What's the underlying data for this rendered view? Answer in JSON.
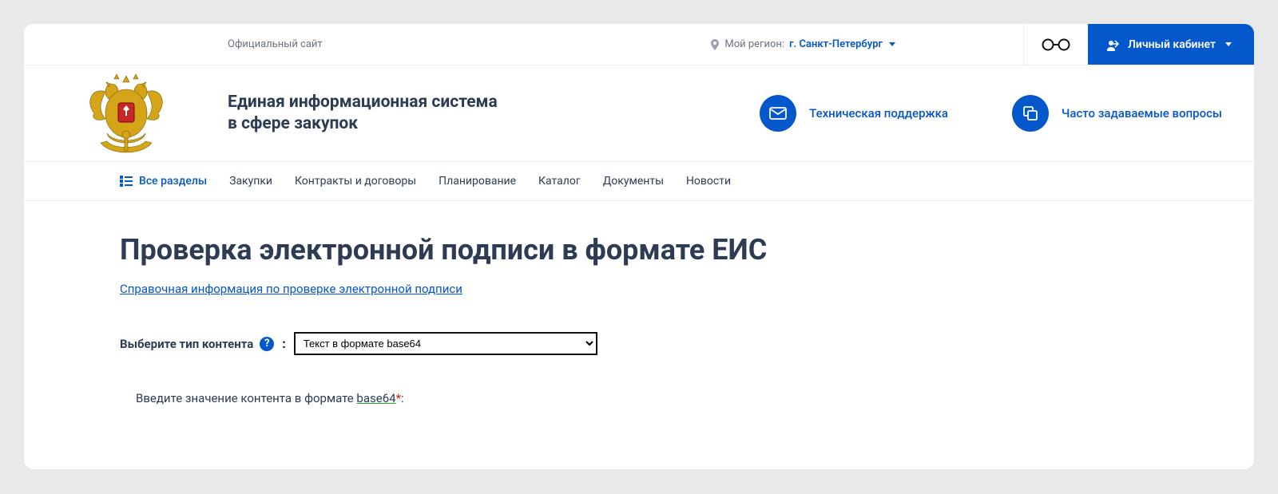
{
  "topbar": {
    "official": "Официальный сайт",
    "region_label": "Мой регион:",
    "region_value": "г. Санкт-Петербург",
    "cabinet": "Личный кабинет"
  },
  "header": {
    "title_line1": "Единая информационная система",
    "title_line2": "в сфере закупок",
    "support": "Техническая поддержка",
    "faq": "Часто задаваемые вопросы"
  },
  "nav": {
    "all": "Все разделы",
    "items": [
      "Закупки",
      "Контракты и договоры",
      "Планирование",
      "Каталог",
      "Документы",
      "Новости"
    ]
  },
  "content": {
    "title": "Проверка электронной подписи в формате ЕИС",
    "help_link": "Справочная информация по проверке электронной подписи",
    "select_label": "Выберите тип контента",
    "select_value": "Текст в формате base64",
    "prompt_prefix": "Введите значение контента в формате ",
    "prompt_underlined": "base64",
    "prompt_suffix": ":"
  }
}
